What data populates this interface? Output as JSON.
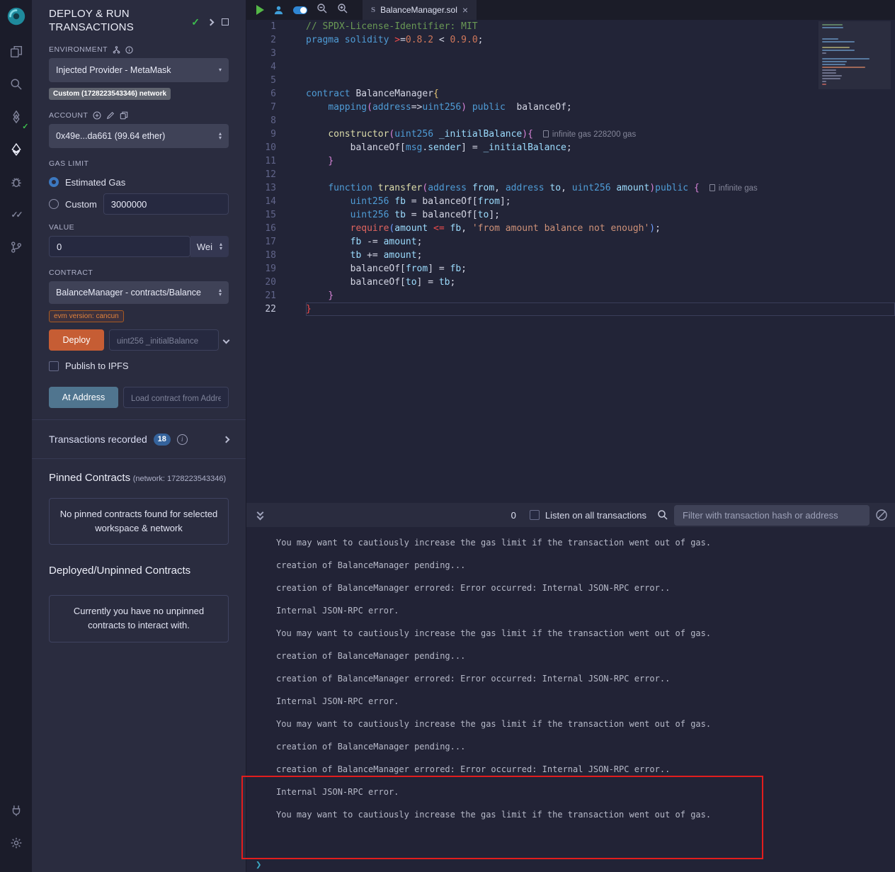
{
  "icons": {
    "check": "✓",
    "double_check": "✓✓",
    "close": "×",
    "caret_up": "▴",
    "caret_down": "▾",
    "prompt": "❯",
    "info_i": "i",
    "sol_glyph": "S"
  },
  "deploy_panel": {
    "title": "DEPLOY & RUN TRANSACTIONS",
    "environment_label": "ENVIRONMENT",
    "environment_value": "Injected Provider - MetaMask",
    "network_badge": "Custom (1728223543346) network",
    "account_label": "ACCOUNT",
    "account_value": "0x49e...da661 (99.64 ether)",
    "gas_limit_label": "GAS LIMIT",
    "gas_estimated_label": "Estimated Gas",
    "gas_custom_label": "Custom",
    "gas_custom_value": "3000000",
    "value_label": "VALUE",
    "value_value": "0",
    "value_unit": "Wei",
    "contract_label": "CONTRACT",
    "contract_value": "BalanceManager - contracts/Balance",
    "evm_badge": "evm version: cancun",
    "deploy_button": "Deploy",
    "deploy_param_placeholder": "uint256 _initialBalance",
    "publish_label": "Publish to IPFS",
    "at_address_button": "At Address",
    "at_address_placeholder": "Load contract from Address",
    "transactions_label": "Transactions recorded",
    "transactions_count": "18",
    "pinned_title": "Pinned Contracts",
    "pinned_network": "(network: 1728223543346)",
    "pinned_empty": "No pinned contracts found for selected workspace & network",
    "deployed_title": "Deployed/Unpinned Contracts",
    "deployed_empty": "Currently you have no unpinned contracts to interact with."
  },
  "editor": {
    "tab": "BalanceManager.sol",
    "active_line": 22,
    "lines": [
      {
        "tokens": [
          [
            "cm",
            "// SPDX-License-Identifier: MIT"
          ]
        ]
      },
      {
        "tokens": [
          [
            "kw",
            "pragma"
          ],
          [
            "pl",
            " "
          ],
          [
            "kw",
            "solidity"
          ],
          [
            "pl",
            " "
          ],
          [
            "red",
            ">"
          ],
          [
            "pl",
            "="
          ],
          [
            "num",
            "0.8.2"
          ],
          [
            "pl",
            " < "
          ],
          [
            "num",
            "0.9.0"
          ],
          [
            "pl",
            ";"
          ]
        ]
      },
      {
        "tokens": []
      },
      {
        "tokens": []
      },
      {
        "tokens": []
      },
      {
        "tokens": [
          [
            "kw",
            "contract"
          ],
          [
            "pl",
            " BalanceManager"
          ],
          [
            "g1",
            "{"
          ]
        ]
      },
      {
        "tokens": [
          [
            "pl",
            "    "
          ],
          [
            "kw",
            "mapping"
          ],
          [
            "g2",
            "("
          ],
          [
            "kw",
            "address"
          ],
          [
            "pl",
            "=>"
          ],
          [
            "kw",
            "uint256"
          ],
          [
            "g2",
            ")"
          ],
          [
            "pl",
            " "
          ],
          [
            "kw",
            "public"
          ],
          [
            "pl",
            "  balanceOf;"
          ]
        ]
      },
      {
        "tokens": []
      },
      {
        "tokens": [
          [
            "pl",
            "    "
          ],
          [
            "fn",
            "constructor"
          ],
          [
            "g2",
            "("
          ],
          [
            "kw",
            "uint256"
          ],
          [
            "pl",
            " "
          ],
          [
            "var",
            "_initialBalance"
          ],
          [
            "g2",
            ")"
          ],
          [
            "g2",
            "{"
          ]
        ],
        "gas": "infinite gas 228200 gas"
      },
      {
        "tokens": [
          [
            "pl",
            "        balanceOf["
          ],
          [
            "kw",
            "msg"
          ],
          [
            "pl",
            "."
          ],
          [
            "var",
            "sender"
          ],
          [
            "pl",
            "] = "
          ],
          [
            "var",
            "_initialBalance"
          ],
          [
            "pl",
            ";"
          ]
        ]
      },
      {
        "tokens": [
          [
            "pl",
            "    "
          ],
          [
            "g2",
            "}"
          ]
        ]
      },
      {
        "tokens": []
      },
      {
        "tokens": [
          [
            "pl",
            "    "
          ],
          [
            "kw",
            "function"
          ],
          [
            "pl",
            " "
          ],
          [
            "fn",
            "transfer"
          ],
          [
            "g2",
            "("
          ],
          [
            "kw",
            "address"
          ],
          [
            "pl",
            " "
          ],
          [
            "var",
            "from"
          ],
          [
            "pl",
            ", "
          ],
          [
            "kw",
            "address"
          ],
          [
            "pl",
            " "
          ],
          [
            "var",
            "to"
          ],
          [
            "pl",
            ", "
          ],
          [
            "kw",
            "uint256"
          ],
          [
            "pl",
            " "
          ],
          [
            "var",
            "amount"
          ],
          [
            "g2",
            ")"
          ],
          [
            "kw",
            "public"
          ],
          [
            "pl",
            " "
          ],
          [
            "g2",
            "{"
          ]
        ],
        "gas": "infinite gas"
      },
      {
        "tokens": [
          [
            "pl",
            "        "
          ],
          [
            "kw",
            "uint256"
          ],
          [
            "pl",
            " "
          ],
          [
            "var",
            "fb"
          ],
          [
            "pl",
            " = balanceOf["
          ],
          [
            "var",
            "from"
          ],
          [
            "pl",
            "];"
          ]
        ]
      },
      {
        "tokens": [
          [
            "pl",
            "        "
          ],
          [
            "kw",
            "uint256"
          ],
          [
            "pl",
            " "
          ],
          [
            "var",
            "tb"
          ],
          [
            "pl",
            " = balanceOf["
          ],
          [
            "var",
            "to"
          ],
          [
            "pl",
            "];"
          ]
        ]
      },
      {
        "tokens": [
          [
            "pl",
            "        "
          ],
          [
            "req",
            "require"
          ],
          [
            "g3",
            "("
          ],
          [
            "var",
            "amount"
          ],
          [
            "pl",
            " "
          ],
          [
            "red",
            "<="
          ],
          [
            "pl",
            " "
          ],
          [
            "var",
            "fb"
          ],
          [
            "pl",
            ", "
          ],
          [
            "str",
            "'from amount balance not enough'"
          ],
          [
            "g3",
            ")"
          ],
          [
            "pl",
            ";"
          ]
        ]
      },
      {
        "tokens": [
          [
            "pl",
            "        "
          ],
          [
            "var",
            "fb"
          ],
          [
            "pl",
            " -= "
          ],
          [
            "var",
            "amount"
          ],
          [
            "pl",
            ";"
          ]
        ]
      },
      {
        "tokens": [
          [
            "pl",
            "        "
          ],
          [
            "var",
            "tb"
          ],
          [
            "pl",
            " += "
          ],
          [
            "var",
            "amount"
          ],
          [
            "pl",
            ";"
          ]
        ]
      },
      {
        "tokens": [
          [
            "pl",
            "        balanceOf["
          ],
          [
            "var",
            "from"
          ],
          [
            "pl",
            "] = "
          ],
          [
            "var",
            "fb"
          ],
          [
            "pl",
            ";"
          ]
        ]
      },
      {
        "tokens": [
          [
            "pl",
            "        balanceOf["
          ],
          [
            "var",
            "to"
          ],
          [
            "pl",
            "] = "
          ],
          [
            "var",
            "tb"
          ],
          [
            "pl",
            ";"
          ]
        ]
      },
      {
        "tokens": [
          [
            "pl",
            "    "
          ],
          [
            "g2",
            "}"
          ]
        ]
      },
      {
        "tokens": [
          [
            "red",
            "}"
          ]
        ]
      }
    ]
  },
  "terminal": {
    "badge": "0",
    "listen_label": "Listen on all transactions",
    "filter_placeholder": "Filter with transaction hash or address",
    "logs": [
      "You may want to cautiously increase the gas limit if the transaction went out of gas.",
      "creation of BalanceManager pending...",
      "creation of BalanceManager errored: Error occurred: Internal JSON-RPC error..",
      "Internal JSON-RPC error.",
      "You may want to cautiously increase the gas limit if the transaction went out of gas.",
      "creation of BalanceManager pending...",
      "creation of BalanceManager errored: Error occurred: Internal JSON-RPC error..",
      "Internal JSON-RPC error.",
      "You may want to cautiously increase the gas limit if the transaction went out of gas.",
      "creation of BalanceManager pending...",
      "creation of BalanceManager errored: Error occurred: Internal JSON-RPC error..",
      "Internal JSON-RPC error.",
      "You may want to cautiously increase the gas limit if the transaction went out of gas."
    ]
  }
}
